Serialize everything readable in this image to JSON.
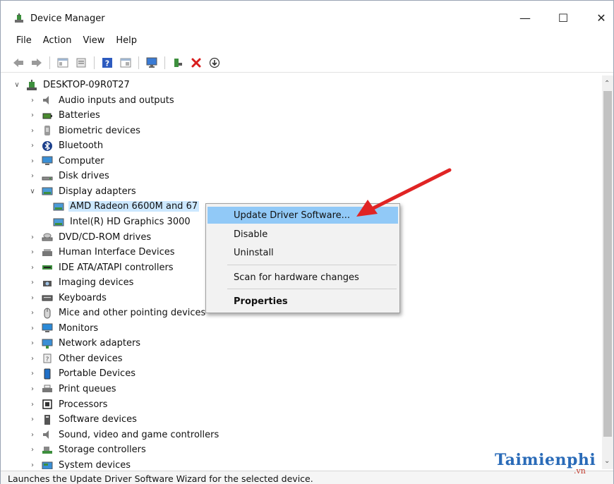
{
  "window": {
    "title": "Device Manager",
    "minimize": "—",
    "maximize": "☐",
    "close": "✕"
  },
  "menu": [
    "File",
    "Action",
    "View",
    "Help"
  ],
  "tree": {
    "root": "DESKTOP-09R0T27",
    "items": [
      {
        "label": "Audio inputs and outputs",
        "icon": "speaker-icon"
      },
      {
        "label": "Batteries",
        "icon": "battery-icon"
      },
      {
        "label": "Biometric devices",
        "icon": "biometric-icon"
      },
      {
        "label": "Bluetooth",
        "icon": "bluetooth-icon"
      },
      {
        "label": "Computer",
        "icon": "computer-icon"
      },
      {
        "label": "Disk drives",
        "icon": "disk-drive-icon"
      },
      {
        "label": "Display adapters",
        "icon": "display-adapter-icon",
        "expanded": true
      },
      {
        "label": "AMD Radeon 6600M and 67",
        "icon": "display-adapter-icon",
        "child": true,
        "selected": true
      },
      {
        "label": "Intel(R) HD Graphics 3000",
        "icon": "display-adapter-icon",
        "child": true
      },
      {
        "label": "DVD/CD-ROM drives",
        "icon": "dvd-drive-icon"
      },
      {
        "label": "Human Interface Devices",
        "icon": "hid-icon"
      },
      {
        "label": "IDE ATA/ATAPI controllers",
        "icon": "ide-controller-icon"
      },
      {
        "label": "Imaging devices",
        "icon": "camera-icon"
      },
      {
        "label": "Keyboards",
        "icon": "keyboard-icon"
      },
      {
        "label": "Mice and other pointing devices",
        "icon": "mouse-icon"
      },
      {
        "label": "Monitors",
        "icon": "monitor-icon"
      },
      {
        "label": "Network adapters",
        "icon": "network-adapter-icon"
      },
      {
        "label": "Other devices",
        "icon": "unknown-device-icon"
      },
      {
        "label": "Portable Devices",
        "icon": "portable-device-icon"
      },
      {
        "label": "Print queues",
        "icon": "printer-icon"
      },
      {
        "label": "Processors",
        "icon": "processor-icon"
      },
      {
        "label": "Software devices",
        "icon": "software-device-icon"
      },
      {
        "label": "Sound, video and game controllers",
        "icon": "speaker-icon"
      },
      {
        "label": "Storage controllers",
        "icon": "storage-controller-icon"
      },
      {
        "label": "System devices",
        "icon": "system-device-icon"
      }
    ]
  },
  "context_menu": {
    "update": "Update Driver Software...",
    "disable": "Disable",
    "uninstall": "Uninstall",
    "scan": "Scan for hardware changes",
    "properties": "Properties"
  },
  "status": "Launches the Update Driver Software Wizard for the selected device.",
  "watermark": {
    "main": "Taimienphi",
    "sub": ".vn"
  },
  "colors": {
    "accent_arrow": "#e02424",
    "selection": "#cce8ff",
    "menu_hover": "#91c9f7",
    "watermark": "#2a6bb8"
  }
}
